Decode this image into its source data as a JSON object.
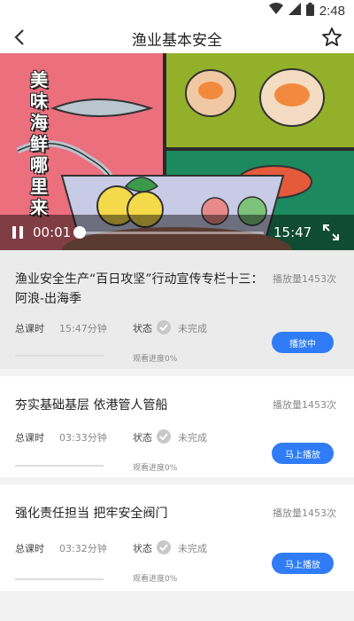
{
  "status_bar": {
    "time": "2:48",
    "icons": [
      "wifi-icon",
      "signal-icon",
      "battery-icon"
    ]
  },
  "header": {
    "title": "渔业基本安全",
    "back_icon": "chevron-left-icon",
    "favorite_icon": "star-outline-icon"
  },
  "video": {
    "art_text": "美味海鲜哪里来",
    "current_time": "00:01",
    "total_time": "15:47",
    "progress_fraction": 0.001,
    "state": "playing",
    "pause_icon": "pause-icon",
    "fullscreen_icon": "fullscreen-icon"
  },
  "labels": {
    "total_hours": "总课时",
    "status": "状态"
  },
  "courses": [
    {
      "title": "渔业安全生产“百日攻坚”行动宣传专栏十三：阿浪-出海季",
      "play_count": "播放量1453次",
      "duration": "15:47分钟",
      "status": "未完成",
      "progress_text": "观看进度0%",
      "action": "播放中",
      "active": true
    },
    {
      "title": "夯实基础基层 依港管人管船",
      "play_count": "播放量1453次",
      "duration": "03:33分钟",
      "status": "未完成",
      "progress_text": "观看进度0%",
      "action": "马上播放",
      "active": false
    },
    {
      "title": "强化责任担当 把牢安全阀门",
      "play_count": "播放量1453次",
      "duration": "03:32分钟",
      "status": "未完成",
      "progress_text": "观看进度0%",
      "action": "马上播放",
      "active": false
    }
  ],
  "colors": {
    "accent": "#2f7cf6",
    "check": "#c8c8c8"
  }
}
